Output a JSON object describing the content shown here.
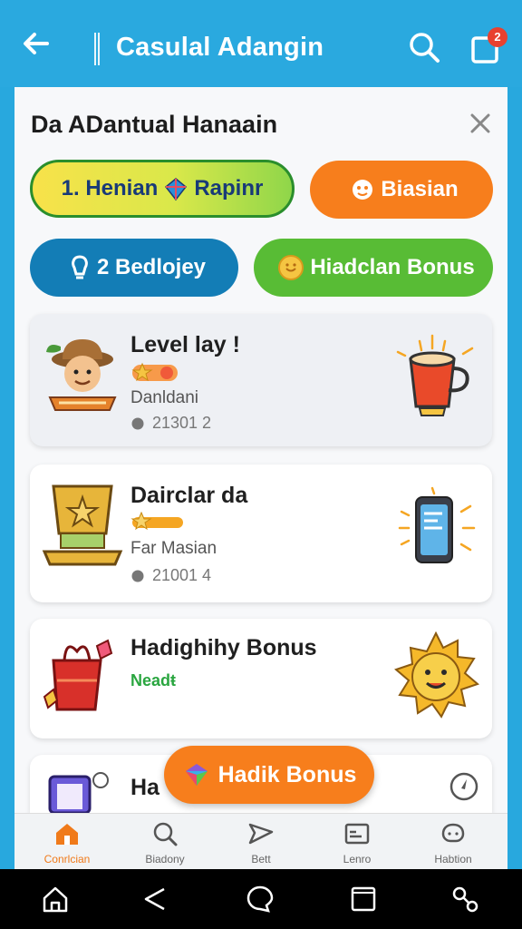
{
  "appbar": {
    "title": "Casulal Adangin",
    "notification_count": "2"
  },
  "sheet": {
    "title": "Da ADantual Hanaain",
    "pills": [
      {
        "label": "1. Henian",
        "label2": "Rapinr",
        "icon": "gem-icon"
      },
      {
        "label": "Biasian",
        "icon": "smiley-icon"
      },
      {
        "label": "2 Bedlojey",
        "icon": "bulb-icon"
      },
      {
        "label": "Hiadclan Bonus",
        "icon": "coin-icon"
      }
    ]
  },
  "cards": [
    {
      "title": "Level lay !",
      "sub": "Danldani",
      "meta": "21301 2",
      "art": "explorer-avatar",
      "right_art": "coffee-cup-icon"
    },
    {
      "title": "Dairclar da",
      "sub": "Far Masian",
      "meta": "21001 4",
      "art": "trophy-scroll",
      "right_art": "phone-icon"
    },
    {
      "title": "Hadighihy Bonus",
      "sub": "Neadŧ",
      "art": "gift-bag",
      "right_art": "sun-face-icon"
    },
    {
      "title": "Ha",
      "art": "tablet-ship",
      "right_art": "compass-icon"
    }
  ],
  "fab": {
    "label": "Hadik Bonus"
  },
  "bottomnav": [
    {
      "label": "Conrlcian",
      "icon": "home-icon",
      "active": true
    },
    {
      "label": "Biadony",
      "icon": "search-icon",
      "active": false
    },
    {
      "label": "Bett",
      "icon": "send-icon",
      "active": false
    },
    {
      "label": "Lenro",
      "icon": "card-icon",
      "active": false
    },
    {
      "label": "Habtion",
      "icon": "chat-icon",
      "active": false
    }
  ],
  "colors": {
    "appbar": "#2aa9df",
    "accent_orange": "#f77e1c",
    "accent_blue": "#137db6",
    "accent_green": "#58bc35"
  }
}
